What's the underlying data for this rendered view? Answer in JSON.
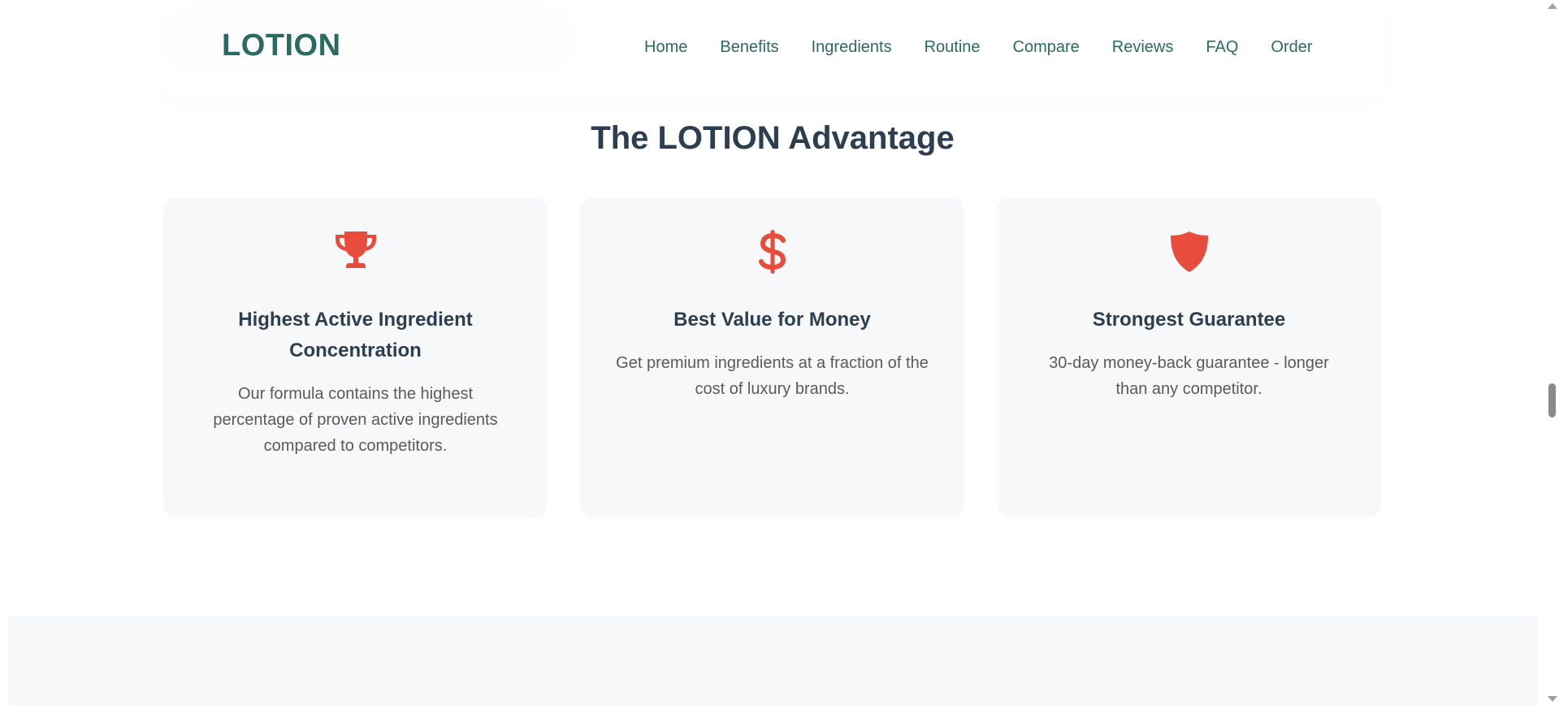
{
  "header": {
    "logo": "LOTION",
    "nav": [
      "Home",
      "Benefits",
      "Ingredients",
      "Routine",
      "Compare",
      "Reviews",
      "FAQ",
      "Order"
    ]
  },
  "section": {
    "title": "The LOTION Advantage",
    "cards": [
      {
        "icon": "trophy-icon",
        "title": "Highest Active Ingredient Concentration",
        "text": "Our formula contains the highest percentage of proven active ingredients compared to competitors."
      },
      {
        "icon": "dollar-icon",
        "title": "Best Value for Money",
        "text": "Get premium ingredients at a fraction of the cost of luxury brands."
      },
      {
        "icon": "shield-icon",
        "title": "Strongest Guarantee",
        "text": "30-day money-back guarantee - longer than any competitor."
      }
    ]
  },
  "colors": {
    "brand": "#2b6a62",
    "accent": "#e84c3d",
    "heading": "#2c3e50",
    "body_text": "#5a5a5a",
    "card_bg": "#f7f8f9"
  }
}
